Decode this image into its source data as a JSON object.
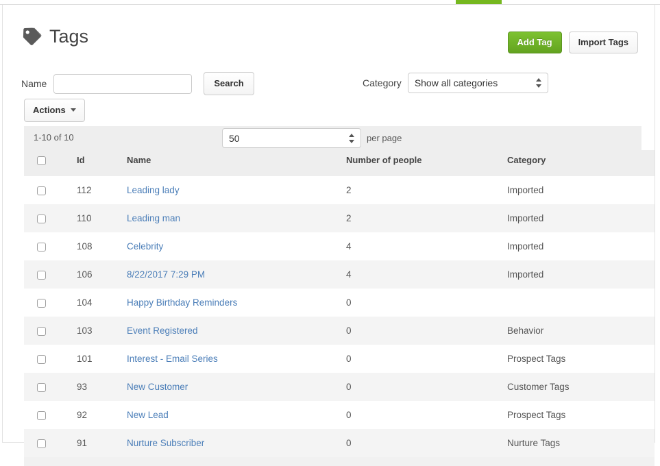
{
  "tabstrip": {
    "active_tab_color": "#76b820"
  },
  "header": {
    "title": "Tags",
    "icon": "tag-icon",
    "add_button": "Add Tag",
    "import_button": "Import Tags",
    "add_button_color": "#6fb32a"
  },
  "filters": {
    "name_label": "Name",
    "name_value": "",
    "name_placeholder": "",
    "search_button": "Search",
    "category_label": "Category",
    "category_value": "Show all categories"
  },
  "actions": {
    "label": "Actions"
  },
  "table": {
    "result_count": "1-10 of 10",
    "per_page_value": "50",
    "per_page_label": "per page",
    "columns": [
      "",
      "Id",
      "Name",
      "Number of people",
      "Category"
    ],
    "rows": [
      {
        "id": "112",
        "name": "Leading lady",
        "people": "2",
        "category": "Imported"
      },
      {
        "id": "110",
        "name": "Leading man",
        "people": "2",
        "category": "Imported"
      },
      {
        "id": "108",
        "name": "Celebrity",
        "people": "4",
        "category": "Imported"
      },
      {
        "id": "106",
        "name": "8/22/2017 7:29 PM",
        "people": "4",
        "category": "Imported"
      },
      {
        "id": "104",
        "name": "Happy Birthday Reminders",
        "people": "0",
        "category": ""
      },
      {
        "id": "103",
        "name": "Event Registered",
        "people": "0",
        "category": "Behavior"
      },
      {
        "id": "101",
        "name": "Interest - Email Series",
        "people": "0",
        "category": "Prospect Tags"
      },
      {
        "id": "93",
        "name": "New Customer",
        "people": "0",
        "category": "Customer Tags"
      },
      {
        "id": "92",
        "name": "New Lead",
        "people": "0",
        "category": "Prospect Tags"
      },
      {
        "id": "91",
        "name": "Nurture Subscriber",
        "people": "0",
        "category": "Nurture Tags"
      }
    ]
  },
  "colors": {
    "link": "#4b7eb8",
    "header_bg": "#eeeeee",
    "stripe": "#f4f4f4",
    "green": "#6fb32a"
  }
}
